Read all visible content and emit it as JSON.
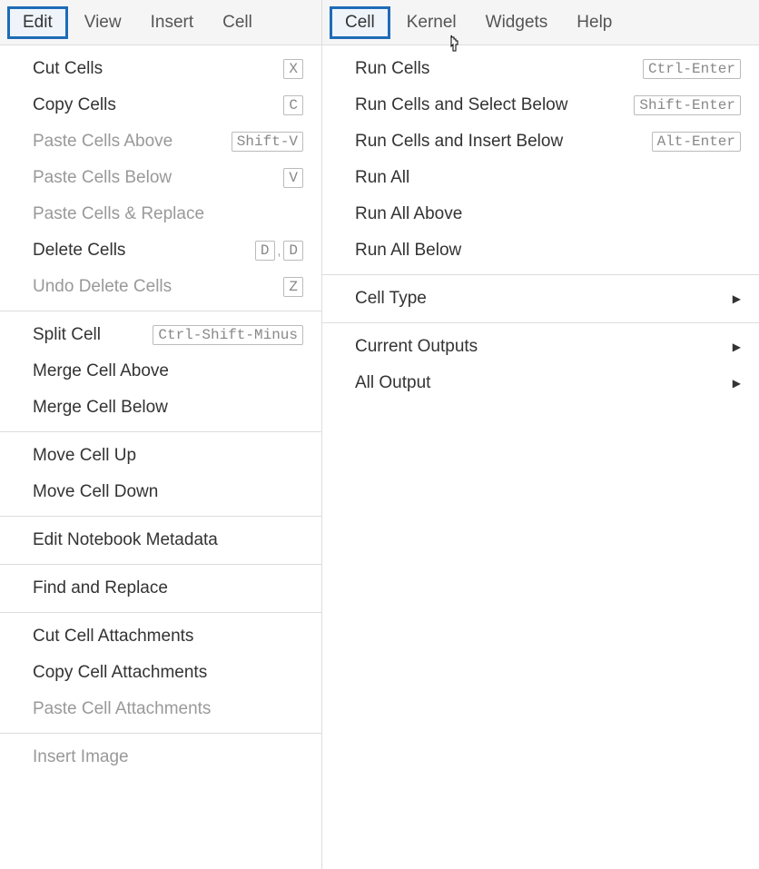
{
  "left": {
    "menubar": [
      {
        "label": "Edit",
        "selected": true
      },
      {
        "label": "View",
        "selected": false
      },
      {
        "label": "Insert",
        "selected": false
      },
      {
        "label": "Cell",
        "selected": false
      }
    ],
    "menu": {
      "cut_cells": "Cut Cells",
      "cut_cells_key": "X",
      "copy_cells": "Copy Cells",
      "copy_cells_key": "C",
      "paste_above": "Paste Cells Above",
      "paste_above_key": "Shift-V",
      "paste_below": "Paste Cells Below",
      "paste_below_key": "V",
      "paste_replace": "Paste Cells & Replace",
      "delete_cells": "Delete Cells",
      "delete_cells_key1": "D",
      "delete_cells_key2": "D",
      "undo_delete": "Undo Delete Cells",
      "undo_delete_key": "Z",
      "split_cell": "Split Cell",
      "split_cell_key": "Ctrl-Shift-Minus",
      "merge_above": "Merge Cell Above",
      "merge_below": "Merge Cell Below",
      "move_up": "Move Cell Up",
      "move_down": "Move Cell Down",
      "edit_metadata": "Edit Notebook Metadata",
      "find_replace": "Find and Replace",
      "cut_attach": "Cut Cell Attachments",
      "copy_attach": "Copy Cell Attachments",
      "paste_attach": "Paste Cell Attachments",
      "insert_image": "Insert Image"
    }
  },
  "right": {
    "menubar": [
      {
        "label": "Cell",
        "selected": true
      },
      {
        "label": "Kernel",
        "selected": false
      },
      {
        "label": "Widgets",
        "selected": false
      },
      {
        "label": "Help",
        "selected": false
      }
    ],
    "menu": {
      "run_cells": "Run Cells",
      "run_cells_key": "Ctrl-Enter",
      "run_select_below": "Run Cells and Select Below",
      "run_select_below_key": "Shift-Enter",
      "run_insert_below": "Run Cells and Insert Below",
      "run_insert_below_key": "Alt-Enter",
      "run_all": "Run All",
      "run_all_above": "Run All Above",
      "run_all_below": "Run All Below",
      "cell_type": "Cell Type",
      "current_outputs": "Current Outputs",
      "all_output": "All Output"
    }
  }
}
